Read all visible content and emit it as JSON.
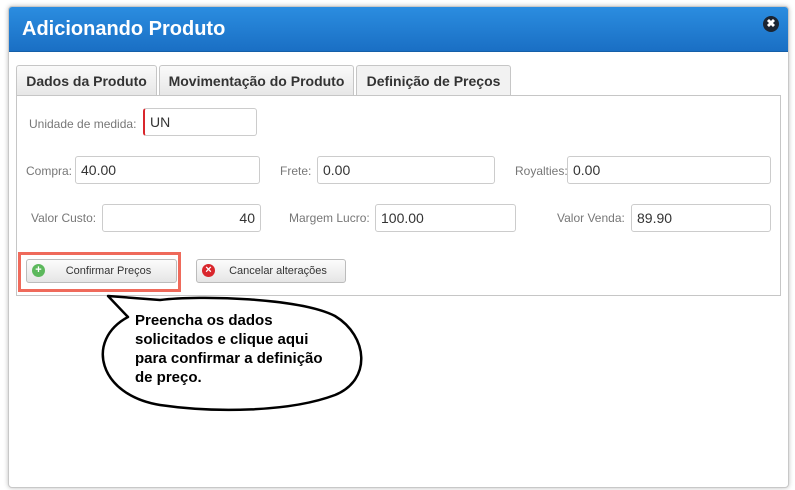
{
  "dialog": {
    "title": "Adicionando Produto",
    "close_symbol": "✖"
  },
  "tabs": [
    {
      "label": "Dados da Produto"
    },
    {
      "label": "Movimentação do Produto"
    },
    {
      "label": "Definição de Preços"
    }
  ],
  "form": {
    "unidade": {
      "label": "Unidade de medida:",
      "value": "UN"
    },
    "compra": {
      "label": "Compra:",
      "value": "40.00"
    },
    "frete": {
      "label": "Frete:",
      "value": "0.00"
    },
    "royalties": {
      "label": "Royalties:",
      "value": "0.00"
    },
    "valor_custo": {
      "label": "Valor Custo:",
      "value": "40"
    },
    "margem_lucro": {
      "label": "Margem Lucro:",
      "value": "100.00"
    },
    "valor_venda": {
      "label": "Valor Venda:",
      "value": "89.90"
    }
  },
  "buttons": {
    "confirm": {
      "label": "Confirmar Preços",
      "icon": "plus-circle-icon",
      "icon_symbol": "+",
      "icon_color": "#5cb85c"
    },
    "cancel": {
      "label": "Cancelar alterações",
      "icon": "cancel-icon",
      "icon_symbol": "×",
      "icon_color": "#d9262c"
    }
  },
  "callout": {
    "text": "Preencha os dados solicitados e clique aqui para confirmar a definição de preço."
  },
  "colors": {
    "titlebar": "#1a6fc4",
    "highlight": "#ef6a5b"
  }
}
